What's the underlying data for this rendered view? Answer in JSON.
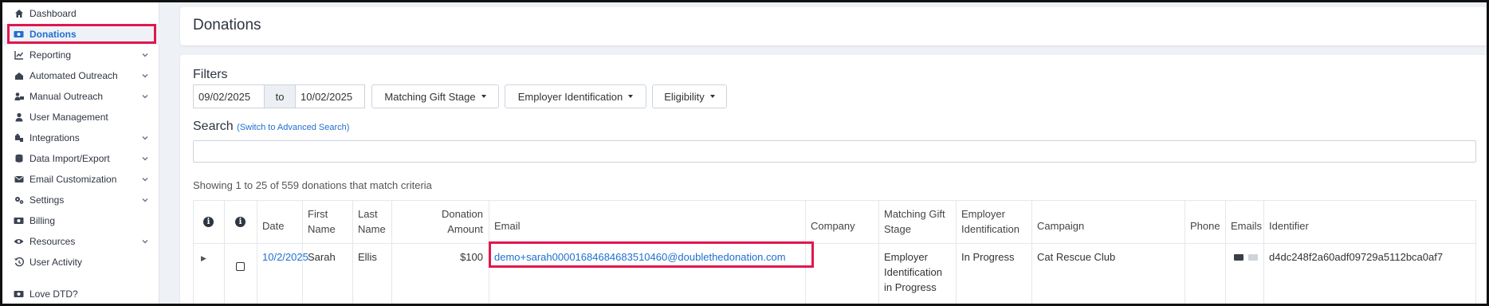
{
  "sidebar": {
    "items": [
      {
        "label": "Dashboard",
        "icon": "home-icon",
        "chevron": false
      },
      {
        "label": "Donations",
        "icon": "donations-icon",
        "chevron": false,
        "active": true
      },
      {
        "label": "Reporting",
        "icon": "chart-icon",
        "chevron": true
      },
      {
        "label": "Automated Outreach",
        "icon": "inbox-icon",
        "chevron": true
      },
      {
        "label": "Manual Outreach",
        "icon": "user-mail-icon",
        "chevron": true
      },
      {
        "label": "User Management",
        "icon": "user-icon",
        "chevron": false
      },
      {
        "label": "Integrations",
        "icon": "puzzle-icon",
        "chevron": true
      },
      {
        "label": "Data Import/Export",
        "icon": "database-icon",
        "chevron": true
      },
      {
        "label": "Email Customization",
        "icon": "envelope-icon",
        "chevron": true
      },
      {
        "label": "Settings",
        "icon": "gears-icon",
        "chevron": true
      },
      {
        "label": "Billing",
        "icon": "billing-icon",
        "chevron": false
      },
      {
        "label": "Resources",
        "icon": "eye-icon",
        "chevron": true
      },
      {
        "label": "User Activity",
        "icon": "history-icon",
        "chevron": false
      }
    ],
    "footer_item": {
      "label": "Love DTD?",
      "icon": "donations-icon"
    }
  },
  "header": {
    "title": "Donations"
  },
  "filters": {
    "label": "Filters",
    "date_from": "09/02/2025",
    "date_separator": "to",
    "date_to": "10/02/2025",
    "dropdowns": [
      "Matching Gift Stage",
      "Employer Identification",
      "Eligibility"
    ]
  },
  "search": {
    "label": "Search",
    "advanced_link": "(Switch to Advanced Search)",
    "value": ""
  },
  "results": {
    "summary": "Showing 1 to 25 of 559 donations that match criteria"
  },
  "table": {
    "headers": {
      "date": "Date",
      "first_name": "First Name",
      "last_name": "Last Name",
      "donation_amount": "Donation Amount",
      "email": "Email",
      "company": "Company",
      "matching_gift_stage": "Matching Gift Stage",
      "employer_identification": "Employer Identification",
      "campaign": "Campaign",
      "phone": "Phone",
      "emails": "Emails",
      "identifier": "Identifier"
    },
    "rows": [
      {
        "date": "10/2/2025",
        "first_name": "Sarah",
        "last_name": "Ellis",
        "donation_amount": "$100",
        "email": "demo+sarah000016846846835​10460@doublethedonation.com",
        "company": "",
        "matching_gift_stage": "Employer Identification in Progress",
        "employer_identification": "In Progress",
        "campaign": "Cat Rescue Club",
        "phone": "",
        "identifier": "d4dc248f2a60adf09729a5112bca0af7"
      }
    ]
  },
  "colors": {
    "accent": "#1f6fd1",
    "highlight": "#e0174f",
    "sidebar_bg": "#ffffff",
    "page_bg": "#eef1f6"
  }
}
